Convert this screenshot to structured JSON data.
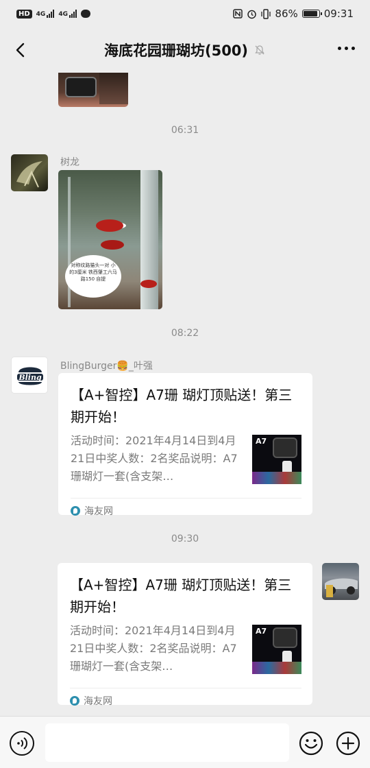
{
  "status_bar": {
    "hd_label": "HD",
    "network_1": "4G",
    "network_2": "4G",
    "battery_percent": "86%",
    "battery_level": 0.86,
    "time": "09:31"
  },
  "header": {
    "title": "海底花园珊瑚坊(500)",
    "back_icon": "chevron-left-icon",
    "mute_icon": "bell-off-icon",
    "more_icon": "more-horizontal-icon"
  },
  "messages": [
    {
      "type": "timestamp",
      "text": "06:31"
    },
    {
      "type": "image",
      "sender": "树龙",
      "image_caption": "对称纹路猫头一对 小的3厘米 铁西肇工六马路150 自提"
    },
    {
      "type": "timestamp",
      "text": "08:22"
    },
    {
      "type": "link_card",
      "sender": "BlingBurger🍔_叶强",
      "avatar_text": "Bling",
      "title": "【A+智控】A7珊 瑚灯顶贴送！第三期开始！",
      "description": "活动时间：2021年4月14日到4月21日中奖人数：2名奖品说明：A7珊瑚灯一套(含支架…",
      "thumb_label": "A7",
      "source": "海友网"
    },
    {
      "type": "timestamp",
      "text": "09:30"
    },
    {
      "type": "link_card_self",
      "title": "【A+智控】A7珊 瑚灯顶贴送！第三期开始！",
      "description": "活动时间：2021年4月14日到4月21日中奖人数：2名奖品说明：A7珊瑚灯一套(含支架…",
      "thumb_label": "A7",
      "source": "海友网"
    }
  ],
  "input_bar": {
    "voice_icon": "voice-icon",
    "emoji_icon": "emoji-icon",
    "plus_icon": "plus-icon"
  }
}
